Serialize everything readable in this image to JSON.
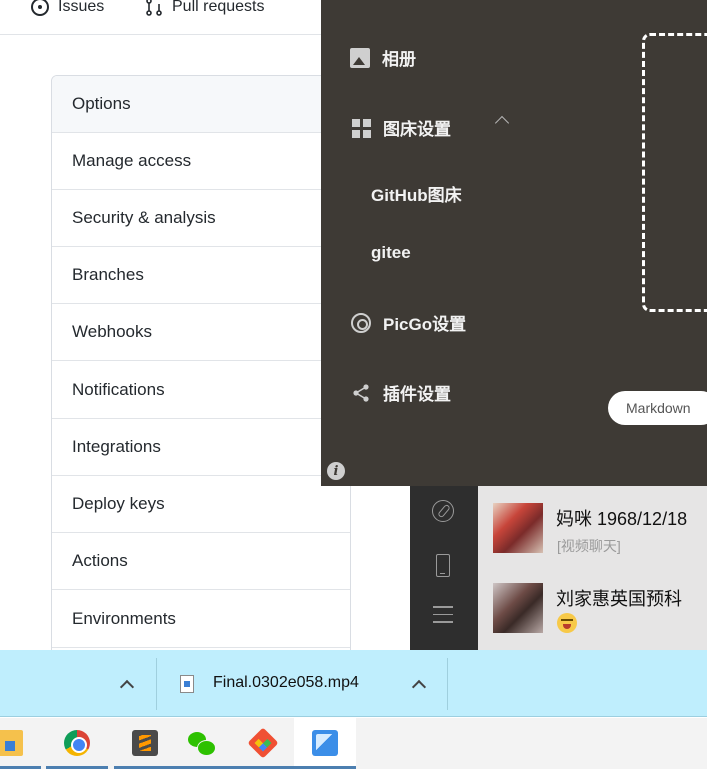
{
  "github": {
    "tabs": [
      {
        "label": "Issues",
        "icon": "issue-opened-icon"
      },
      {
        "label": "Pull requests",
        "icon": "git-pull-request-icon"
      }
    ],
    "settings_menu": [
      "Options",
      "Manage access",
      "Security & analysis",
      "Branches",
      "Webhooks",
      "Notifications",
      "Integrations",
      "Deploy keys",
      "Actions",
      "Environments"
    ]
  },
  "picgo": {
    "nav": {
      "album": {
        "label": "相册",
        "icon": "image-icon"
      },
      "image_host": {
        "label": "图床设置",
        "icon": "grid-icon"
      },
      "github_host": {
        "label": "GitHub图床"
      },
      "gitee": {
        "label": "gitee"
      },
      "picgo_settings": {
        "label": "PicGo设置",
        "icon": "gear-icon"
      },
      "plugin_settings": {
        "label": "插件设置",
        "icon": "share-icon"
      }
    },
    "markdown_label": "Markdown",
    "info_icon": "i",
    "colors": {
      "panel_bg": "#3e3a35",
      "text": "#f2f2f2"
    }
  },
  "wechat": {
    "chats": [
      {
        "name": "妈咪 1968/12/18",
        "preview": "[视频聊天]"
      },
      {
        "name": "刘家惠英国预科",
        "preview_icon": "grinning-emoji-icon"
      }
    ]
  },
  "download_bar": {
    "filename": "Final.0302e058.mp4",
    "colors": {
      "bg": "#bfeefd"
    }
  },
  "taskbar": {
    "apps": [
      {
        "name": "file-explorer"
      },
      {
        "name": "chrome"
      },
      {
        "name": "sublime-text"
      },
      {
        "name": "wechat"
      },
      {
        "name": "git"
      },
      {
        "name": "picgo",
        "active": true
      }
    ]
  }
}
